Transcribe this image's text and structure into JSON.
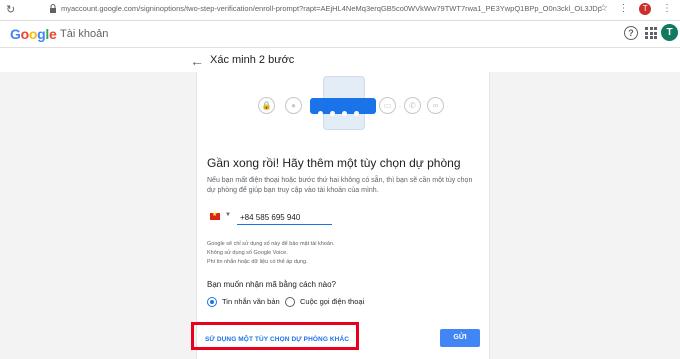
{
  "browser": {
    "url": "myaccount.google.com/signinoptions/two-step-verification/enroll-prompt?rapt=AEjHL4NeMq3erqGB5co0WVkWw79TWT7rwa1_PE3YwpQ1BPp_O0n3ckl_OL3JDpC2LzUGDqXYtstu7N3B8_psZ_V...",
    "profile_letter": "T"
  },
  "header": {
    "logo": [
      "G",
      "o",
      "o",
      "g",
      "l",
      "e"
    ],
    "product": "Tài khoản",
    "avatar_letter": "T"
  },
  "subheader": {
    "title": "Xác minh 2 bước"
  },
  "main": {
    "heading": "Gần xong rồi! Hãy thêm một tùy chọn dự phòng",
    "description": "Nếu bạn mất điện thoại hoặc bước thứ hai không có sẵn, thì bạn sẽ cần một tùy chọn dự phòng để giúp bạn truy cập vào tài khoản của mình.",
    "phone_number": "+84 585 695 940",
    "notes": [
      "Google sẽ chỉ sử dụng số này để bảo mật tài khoản.",
      "Không sử dụng số Google Voice.",
      "Phí tin nhắn hoặc dữ liệu có thể áp dụng."
    ],
    "question": "Bạn muốn nhận mã bằng cách nào?",
    "options": [
      {
        "label": "Tin nhắn văn bản",
        "selected": true
      },
      {
        "label": "Cuộc gọi điện thoại",
        "selected": false
      }
    ],
    "other_option_link": "SỬ DỤNG MỘT TÙY CHỌN DỰ PHÒNG KHÁC",
    "send_button": "GỬI"
  },
  "colors": {
    "accent": "#1a73e8",
    "highlight": "#e8001c",
    "avatar": "#0f7a5f"
  }
}
